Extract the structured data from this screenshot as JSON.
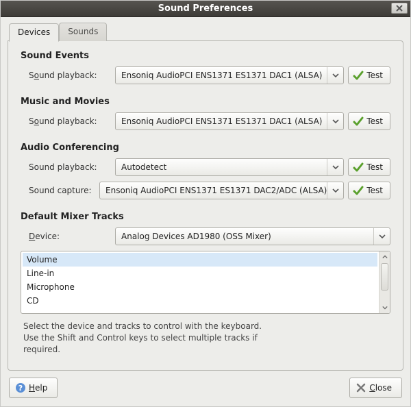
{
  "window": {
    "title": "Sound Preferences"
  },
  "tabs": {
    "devices": "Devices",
    "sounds": "Sounds"
  },
  "sections": {
    "sound_events": {
      "title": "Sound Events",
      "playback_label_pre": "S",
      "playback_label_u": "o",
      "playback_label_post": "und playback:",
      "playback_value": "Ensoniq AudioPCI ENS1371 ES1371 DAC1 (ALSA)"
    },
    "music_movies": {
      "title": "Music and Movies",
      "playback_label_pre": "S",
      "playback_label_u": "o",
      "playback_label_post": "und playback:",
      "playback_value": "Ensoniq AudioPCI ENS1371 ES1371 DAC1 (ALSA)"
    },
    "audio_conf": {
      "title": "Audio Conferencing",
      "playback_label": "Sound playback:",
      "playback_value": "Autodetect",
      "capture_label": "Sound capture:",
      "capture_value": "Ensoniq AudioPCI ENS1371 ES1371 DAC2/ADC (ALSA)"
    },
    "mixer": {
      "title": "Default Mixer Tracks",
      "device_label_u": "D",
      "device_label_post": "evice:",
      "device_value": "Analog Devices AD1980 (OSS Mixer)",
      "tracks": [
        "Volume",
        "Line-in",
        "Microphone",
        "CD"
      ],
      "help_l1": "Select the device and tracks to control with the keyboard.",
      "help_l2": "Use the Shift and Control keys to select multiple tracks if",
      "help_l3": "required."
    }
  },
  "buttons": {
    "test": "Test",
    "help_u": "H",
    "help_post": "elp",
    "close_u": "C",
    "close_post": "lose"
  }
}
